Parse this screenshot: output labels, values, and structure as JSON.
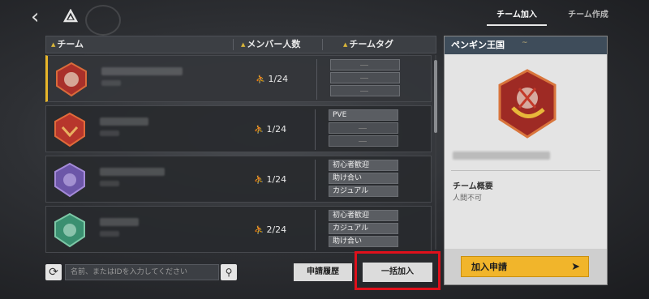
{
  "header": {
    "back_icon": "back-arrow-icon",
    "logo_icon": "triangle-logo-icon",
    "tabs": [
      {
        "label": "チーム加入",
        "active": true
      },
      {
        "label": "チーム作成",
        "active": false
      }
    ]
  },
  "table": {
    "columns": [
      "チーム",
      "メンバー人数",
      "チームタグ"
    ],
    "rows": [
      {
        "members": "1/24",
        "tags": [
          "",
          "",
          "",
          ""
        ],
        "emblem_color": "#b23a32",
        "selected": true
      },
      {
        "members": "1/24",
        "tags": [
          "PVE",
          "",
          ""
        ],
        "emblem_color": "#b7362c",
        "selected": false
      },
      {
        "members": "1/24",
        "tags": [
          "初心者歓迎",
          "助け合い",
          "カジュアル"
        ],
        "emblem_color": "#7c64b8",
        "selected": false
      },
      {
        "members": "2/24",
        "tags": [
          "初心者歓迎",
          "カジュアル",
          "助け合い"
        ],
        "emblem_color": "#3f9a78",
        "selected": false
      }
    ]
  },
  "footer": {
    "search_placeholder": "名前、またはIDを入力してください",
    "history_button": "申請履歴",
    "bulk_join_button": "一括加入"
  },
  "detail": {
    "team_name": "ペンギン王国",
    "overview_label": "チーム概要",
    "overview_value": "人間不可",
    "join_button": "加入申請"
  },
  "colors": {
    "accent": "#f1b52b",
    "highlight": "#e0101b",
    "panel_header": "#3e4c5a"
  }
}
